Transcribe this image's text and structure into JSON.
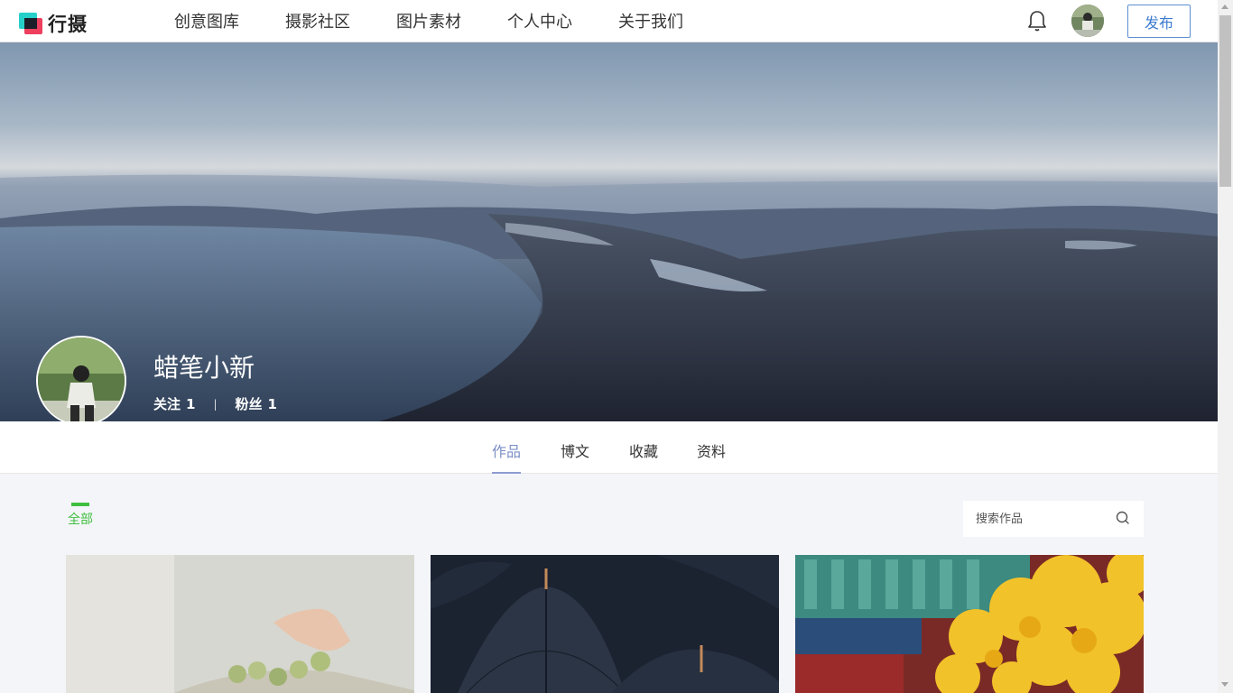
{
  "header": {
    "logo_text": "行摄",
    "nav": [
      "创意图库",
      "摄影社区",
      "图片素材",
      "个人中心",
      "关于我们"
    ],
    "publish_label": "发布",
    "icons": [
      "bell-icon",
      "user-avatar"
    ]
  },
  "profile": {
    "username": "蜡笔小新",
    "following_label": "关注",
    "following_count": "1",
    "followers_label": "粉丝",
    "followers_count": "1",
    "separator": "|"
  },
  "tabs": [
    "作品",
    "博文",
    "收藏",
    "资料"
  ],
  "active_tab": "作品",
  "filter": {
    "all_label": "全部",
    "search_placeholder": "搜索作品"
  },
  "colors": {
    "accent_green": "#3fbf3f",
    "tab_active": "#7b8fc7",
    "publish_blue": "#3c7bd1"
  }
}
